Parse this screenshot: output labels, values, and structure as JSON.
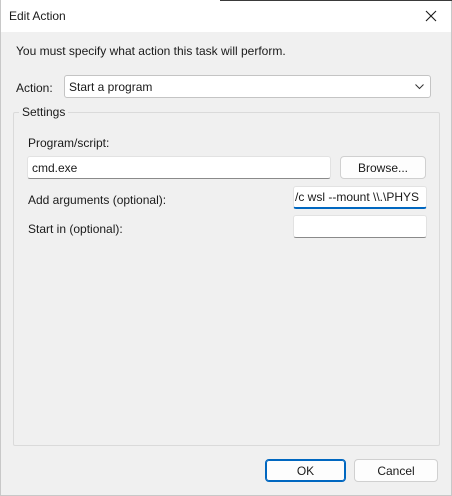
{
  "window": {
    "title": "Edit Action"
  },
  "prompt": "You must specify what action this task will perform.",
  "action": {
    "label": "Action:",
    "selected": "Start a program"
  },
  "settings": {
    "legend": "Settings",
    "program_label": "Program/script:",
    "program_value": "cmd.exe",
    "browse_label": "Browse...",
    "arguments_label": "Add arguments (optional):",
    "arguments_value": "/c wsl --mount \\\\.\\PHYS",
    "start_in_label": "Start in (optional):",
    "start_in_value": ""
  },
  "buttons": {
    "ok": "OK",
    "cancel": "Cancel"
  }
}
